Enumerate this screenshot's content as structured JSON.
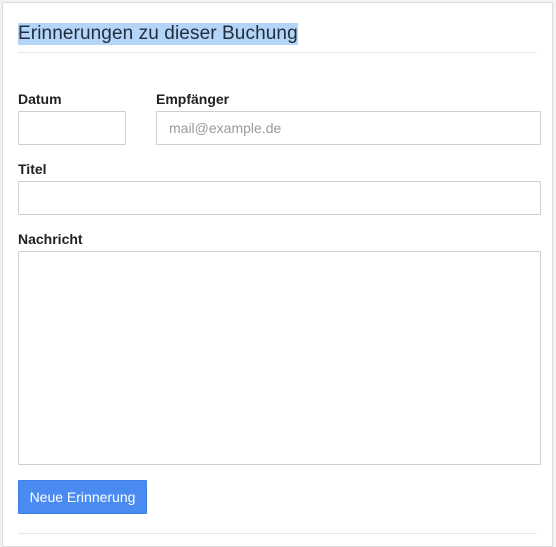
{
  "panel": {
    "title": "Erinnerungen zu dieser Buchung"
  },
  "form": {
    "date": {
      "label": "Datum",
      "value": "",
      "placeholder": ""
    },
    "recipient": {
      "label": "Empfänger",
      "value": "",
      "placeholder": "mail@example.de"
    },
    "title": {
      "label": "Titel",
      "value": "",
      "placeholder": ""
    },
    "message": {
      "label": "Nachricht",
      "value": "",
      "placeholder": ""
    },
    "submit_label": "Neue Erinnerung"
  },
  "colors": {
    "primary_button": "#4a8bf2",
    "title_highlight": "#b4d5f7"
  }
}
